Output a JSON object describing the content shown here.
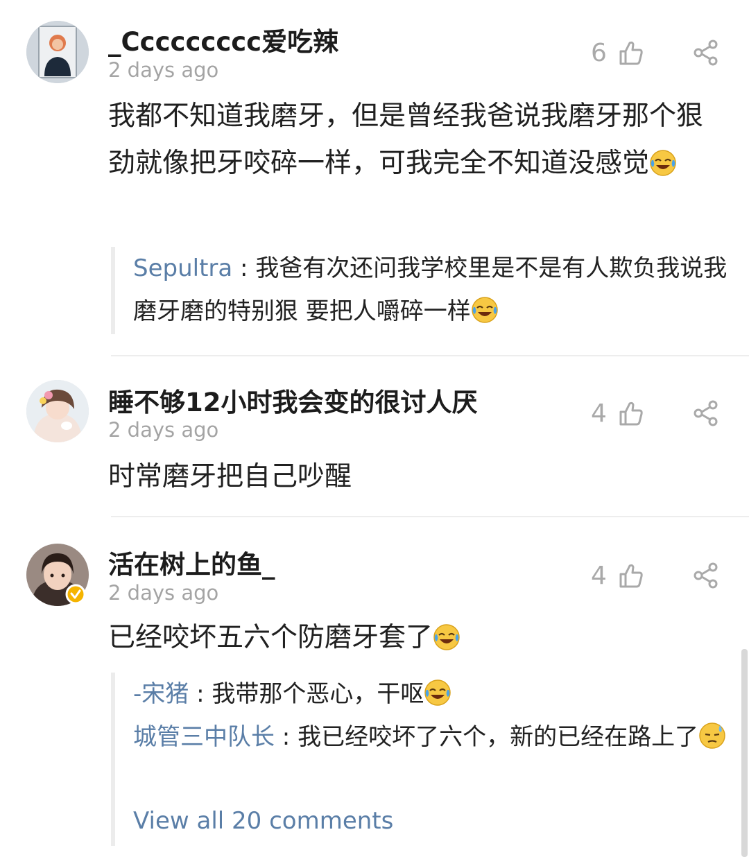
{
  "comments": [
    {
      "username": "_Ccccccccc爱吃辣",
      "time": "2 days ago",
      "likes": "6",
      "text": "我都不知道我磨牙，但是曾经我爸说我磨牙那个狠劲就像把牙咬碎一样，可我完全不知道没感觉",
      "replies": [
        {
          "author": "Sepultra",
          "sep": " : ",
          "text": "我爸有次还问我学校里是不是有人欺负我说我磨牙磨的特别狠 要把人嚼碎一样"
        }
      ]
    },
    {
      "username": "睡不够12小时我会变的很讨人厌",
      "time": "2 days ago",
      "likes": "4",
      "text": "时常磨牙把自己吵醒"
    },
    {
      "username": "活在树上的鱼_",
      "time": "2 days ago",
      "likes": "4",
      "text": "已经咬坏五六个防磨牙套了",
      "replies": [
        {
          "author": "-宋猪",
          "sep": " : ",
          "text": "我带那个恶心，干呕"
        },
        {
          "author": "城管三中队长",
          "sep": " : ",
          "text": "我已经咬坏了六个，新的已经在路上了"
        }
      ],
      "view_all": "View all 20 comments"
    }
  ],
  "icons": {
    "like": "thumbs-up-icon",
    "share": "share-icon",
    "laugh_cry": "laugh-cry-emoji",
    "sweat": "sweat-emoji",
    "verified": "verified-badge-icon"
  },
  "colors": {
    "link": "#5a7ea7",
    "muted": "#a4a4a4",
    "text": "#202020"
  }
}
